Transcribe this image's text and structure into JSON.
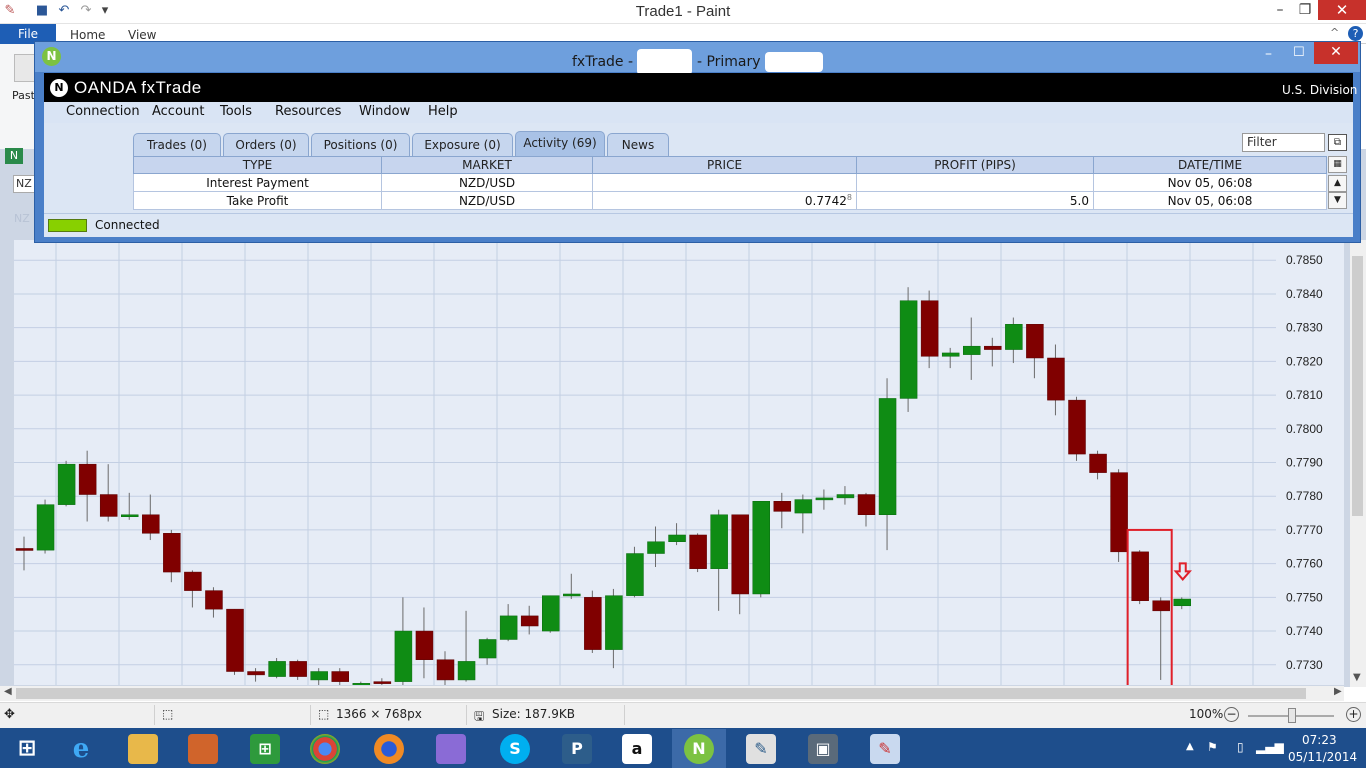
{
  "paint": {
    "title": "Trade1 - Paint",
    "file_tab": "File",
    "tabs": [
      "Home",
      "View"
    ],
    "paste_label": "Past",
    "status": {
      "dimensions": "1366 × 768px",
      "size": "Size: 187.9KB",
      "zoom": "100%"
    }
  },
  "fx": {
    "title_prefix": "fxTrade -",
    "title_mid": "- Primary",
    "brand": "OANDA fxTrade",
    "division": "U.S. Division",
    "menu": [
      "Connection",
      "Account",
      "Tools",
      "Resources",
      "Window",
      "Help"
    ],
    "tabs": [
      "Trades (0)",
      "Orders (0)",
      "Positions (0)",
      "Exposure (0)",
      "Activity (69)",
      "News"
    ],
    "selected_tab": "Activity (69)",
    "filter_placeholder": "Filter",
    "columns": [
      "TYPE",
      "MARKET",
      "PRICE",
      "PROFIT (PIPS)",
      "DATE/TIME"
    ],
    "rows": [
      {
        "type": "Interest Payment",
        "market": "NZD/USD",
        "price": "",
        "profit": "",
        "date": "Nov 05, 06:08"
      },
      {
        "type": "Take Profit",
        "market": "NZD/USD",
        "price": "0.7742",
        "price_sup": "8",
        "profit": "5.0",
        "date": "Nov 05, 06:08"
      }
    ],
    "connection_status": "Connected",
    "left_instrument": "NZ",
    "left_ghost": "NZ"
  },
  "taskbar": {
    "time": "07:23",
    "date": "05/11/2014"
  },
  "chart_data": {
    "type": "candlestick",
    "instrument": "NZD/USD",
    "y_ticks": [
      "0.7850",
      "0.7840",
      "0.7830",
      "0.7820",
      "0.7810",
      "0.7800",
      "0.7790",
      "0.7780",
      "0.7770",
      "0.7760",
      "0.7750",
      "0.7740",
      "0.7730"
    ],
    "ylim": [
      0.7724,
      0.7856
    ],
    "candles": [
      {
        "o": 0.77645,
        "c": 0.7764,
        "h": 0.7768,
        "l": 0.7758
      },
      {
        "o": 0.7764,
        "c": 0.77775,
        "h": 0.7779,
        "l": 0.7763
      },
      {
        "o": 0.77775,
        "c": 0.77895,
        "h": 0.77905,
        "l": 0.7777
      },
      {
        "o": 0.77895,
        "c": 0.77805,
        "h": 0.77935,
        "l": 0.77725
      },
      {
        "o": 0.77805,
        "c": 0.7774,
        "h": 0.77895,
        "l": 0.77725
      },
      {
        "o": 0.7774,
        "c": 0.77745,
        "h": 0.7781,
        "l": 0.7773
      },
      {
        "o": 0.77745,
        "c": 0.7769,
        "h": 0.77805,
        "l": 0.7767
      },
      {
        "o": 0.7769,
        "c": 0.77575,
        "h": 0.777,
        "l": 0.77545
      },
      {
        "o": 0.77575,
        "c": 0.7752,
        "h": 0.7758,
        "l": 0.7747
      },
      {
        "o": 0.7752,
        "c": 0.77465,
        "h": 0.7753,
        "l": 0.7744
      },
      {
        "o": 0.77465,
        "c": 0.7728,
        "h": 0.77465,
        "l": 0.7727
      },
      {
        "o": 0.7728,
        "c": 0.7727,
        "h": 0.7729,
        "l": 0.7725
      },
      {
        "o": 0.77265,
        "c": 0.7731,
        "h": 0.7732,
        "l": 0.7726
      },
      {
        "o": 0.7731,
        "c": 0.77265,
        "h": 0.77315,
        "l": 0.77255
      },
      {
        "o": 0.77255,
        "c": 0.7728,
        "h": 0.7729,
        "l": 0.7724
      },
      {
        "o": 0.7728,
        "c": 0.7725,
        "h": 0.7729,
        "l": 0.7724
      },
      {
        "o": 0.7724,
        "c": 0.77245,
        "h": 0.7725,
        "l": 0.7723
      },
      {
        "o": 0.7725,
        "c": 0.77245,
        "h": 0.7726,
        "l": 0.7723
      },
      {
        "o": 0.7725,
        "c": 0.774,
        "h": 0.775,
        "l": 0.7724
      },
      {
        "o": 0.774,
        "c": 0.77315,
        "h": 0.7747,
        "l": 0.7726
      },
      {
        "o": 0.77315,
        "c": 0.77255,
        "h": 0.7734,
        "l": 0.7724
      },
      {
        "o": 0.77255,
        "c": 0.7731,
        "h": 0.7746,
        "l": 0.7725
      },
      {
        "o": 0.7732,
        "c": 0.77375,
        "h": 0.7738,
        "l": 0.773
      },
      {
        "o": 0.77375,
        "c": 0.77445,
        "h": 0.7748,
        "l": 0.7737
      },
      {
        "o": 0.77445,
        "c": 0.77415,
        "h": 0.77475,
        "l": 0.7739
      },
      {
        "o": 0.774,
        "c": 0.77505,
        "h": 0.77505,
        "l": 0.77395
      },
      {
        "o": 0.77505,
        "c": 0.7751,
        "h": 0.7757,
        "l": 0.77495
      },
      {
        "o": 0.775,
        "c": 0.77345,
        "h": 0.7752,
        "l": 0.77335
      },
      {
        "o": 0.77345,
        "c": 0.77505,
        "h": 0.77525,
        "l": 0.7729
      },
      {
        "o": 0.77505,
        "c": 0.7763,
        "h": 0.7765,
        "l": 0.775
      },
      {
        "o": 0.7763,
        "c": 0.77665,
        "h": 0.7771,
        "l": 0.7759
      },
      {
        "o": 0.77665,
        "c": 0.77685,
        "h": 0.7772,
        "l": 0.77655
      },
      {
        "o": 0.77685,
        "c": 0.77585,
        "h": 0.7769,
        "l": 0.77575
      },
      {
        "o": 0.77585,
        "c": 0.77745,
        "h": 0.7776,
        "l": 0.7746
      },
      {
        "o": 0.77745,
        "c": 0.7751,
        "h": 0.77745,
        "l": 0.7745
      },
      {
        "o": 0.7751,
        "c": 0.77785,
        "h": 0.77785,
        "l": 0.775
      },
      {
        "o": 0.77785,
        "c": 0.77755,
        "h": 0.7781,
        "l": 0.77705
      },
      {
        "o": 0.7775,
        "c": 0.7779,
        "h": 0.77805,
        "l": 0.7769
      },
      {
        "o": 0.7779,
        "c": 0.77795,
        "h": 0.7782,
        "l": 0.7776
      },
      {
        "o": 0.77795,
        "c": 0.77805,
        "h": 0.7783,
        "l": 0.77775
      },
      {
        "o": 0.77805,
        "c": 0.77745,
        "h": 0.7781,
        "l": 0.7771
      },
      {
        "o": 0.77745,
        "c": 0.7809,
        "h": 0.7815,
        "l": 0.7764
      },
      {
        "o": 0.7809,
        "c": 0.7838,
        "h": 0.7842,
        "l": 0.7805
      },
      {
        "o": 0.7838,
        "c": 0.78215,
        "h": 0.7841,
        "l": 0.7818
      },
      {
        "o": 0.78215,
        "c": 0.78225,
        "h": 0.7824,
        "l": 0.7818
      },
      {
        "o": 0.7822,
        "c": 0.78245,
        "h": 0.7833,
        "l": 0.78145
      },
      {
        "o": 0.78245,
        "c": 0.78235,
        "h": 0.7827,
        "l": 0.78185
      },
      {
        "o": 0.78235,
        "c": 0.7831,
        "h": 0.7833,
        "l": 0.78195
      },
      {
        "o": 0.7831,
        "c": 0.7821,
        "h": 0.7831,
        "l": 0.7815
      },
      {
        "o": 0.7821,
        "c": 0.78085,
        "h": 0.7825,
        "l": 0.7804
      },
      {
        "o": 0.78085,
        "c": 0.77925,
        "h": 0.78095,
        "l": 0.77905
      },
      {
        "o": 0.77925,
        "c": 0.7787,
        "h": 0.77935,
        "l": 0.7785
      },
      {
        "o": 0.7787,
        "c": 0.77635,
        "h": 0.7788,
        "l": 0.77605
      },
      {
        "o": 0.77635,
        "c": 0.7749,
        "h": 0.7764,
        "l": 0.7748
      },
      {
        "o": 0.7749,
        "c": 0.7746,
        "h": 0.775,
        "l": 0.77255
      },
      {
        "o": 0.77475,
        "c": 0.77495,
        "h": 0.775,
        "l": 0.77465
      }
    ],
    "highlight_box": {
      "from_index": 53,
      "to_index": 54,
      "top": 0.777
    }
  }
}
